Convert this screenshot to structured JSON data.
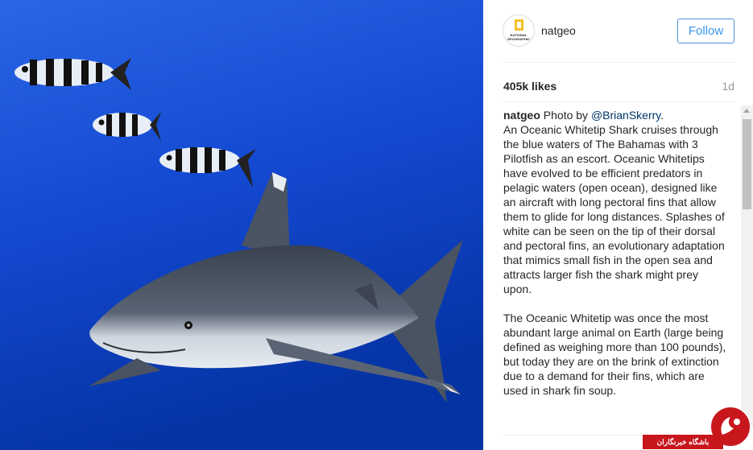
{
  "post": {
    "image_alt": "Oceanic whitetip shark swimming with three pilotfish in blue water"
  },
  "header": {
    "avatar_text": "NATIONAL GEOGRAPHIC",
    "username": "natgeo",
    "follow_label": "Follow"
  },
  "stats": {
    "likes": "405k likes",
    "age": "1d"
  },
  "caption": {
    "username": "natgeo",
    "photo_by": " Photo by ",
    "mention": "@BrianSkerry",
    "mention_end": ".",
    "para1": "An Oceanic Whitetip Shark cruises through the blue waters of The Bahamas with 3 Pilotfish as an escort. Oceanic Whitetips have evolved to be efficient predators in pelagic waters (open ocean), designed like an aircraft with long pectoral fins that allow them to glide for long distances. Splashes of white can be seen on the tip of their dorsal and pectoral fins, an evolutionary adaptation that mimics small fish in the open sea and attracts larger fish the shark might prey upon.",
    "para2": "The Oceanic Whitetip was once the most abundant large animal on Earth (large being defined as weighing more than 100 pounds), but today they are on the brink of extinction due to a demand for their fins, which are used in shark fin soup."
  },
  "watermark": {
    "label": "باشگاه خبرنگاران"
  },
  "colors": {
    "follow_blue": "#3897f0",
    "water_top": "#1a4fd8",
    "water_bottom": "#0633a8",
    "watermark_red": "#c8161d"
  },
  "icons": {
    "scroll_up": "triangle-up-icon",
    "watermark_logo": "news-agency-logo-icon"
  }
}
